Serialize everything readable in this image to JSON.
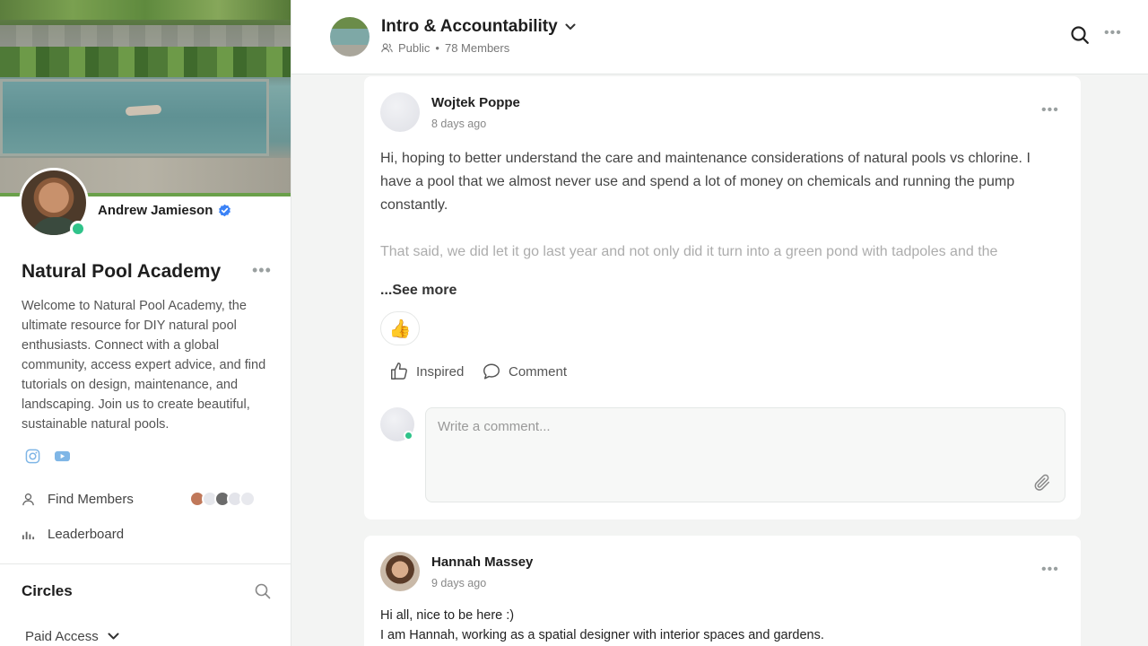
{
  "sidebar": {
    "owner_name": "Andrew Jamieson",
    "community_title": "Natural Pool Academy",
    "description": "Welcome to Natural Pool Academy, the ultimate resource for DIY natural pool enthusiasts. Connect with a global community, access expert advice, and find tutorials on design, maintenance, and landscaping. Join us to create beautiful, sustainable natural pools.",
    "social_icons": [
      "instagram-icon",
      "youtube-icon"
    ],
    "menu": [
      {
        "label": "Find Members",
        "icon": "user-icon"
      },
      {
        "label": "Leaderboard",
        "icon": "bar-chart-icon"
      }
    ],
    "circles_title": "Circles",
    "paid_access_label": "Paid Access"
  },
  "header": {
    "title": "Intro & Accountability",
    "visibility": "Public",
    "separator": "•",
    "members": "78 Members"
  },
  "posts": [
    {
      "author": "Wojtek Poppe",
      "time": "8 days ago",
      "body_p1": "Hi, hoping to better understand the care and maintenance considerations of natural pools vs chlorine. I have a pool that we almost never use and spend a lot of money on chemicals and running the pump constantly.",
      "body_p2": "That said, we did let it go last year and not only did it turn into a green pond with tadpoles and the",
      "see_more": "...See more",
      "reaction": "👍",
      "inspired_label": "Inspired",
      "comment_label": "Comment",
      "comment_placeholder": "Write a comment..."
    },
    {
      "author": "Hannah Massey",
      "time": "9 days ago",
      "line1": "Hi all, nice to be here :)",
      "line2": "I am Hannah, working as a spatial designer with interior spaces and gardens."
    }
  ],
  "colors": {
    "online": "#2fc38a",
    "verified": "#3b82f6",
    "social": "#7fb6e6"
  }
}
